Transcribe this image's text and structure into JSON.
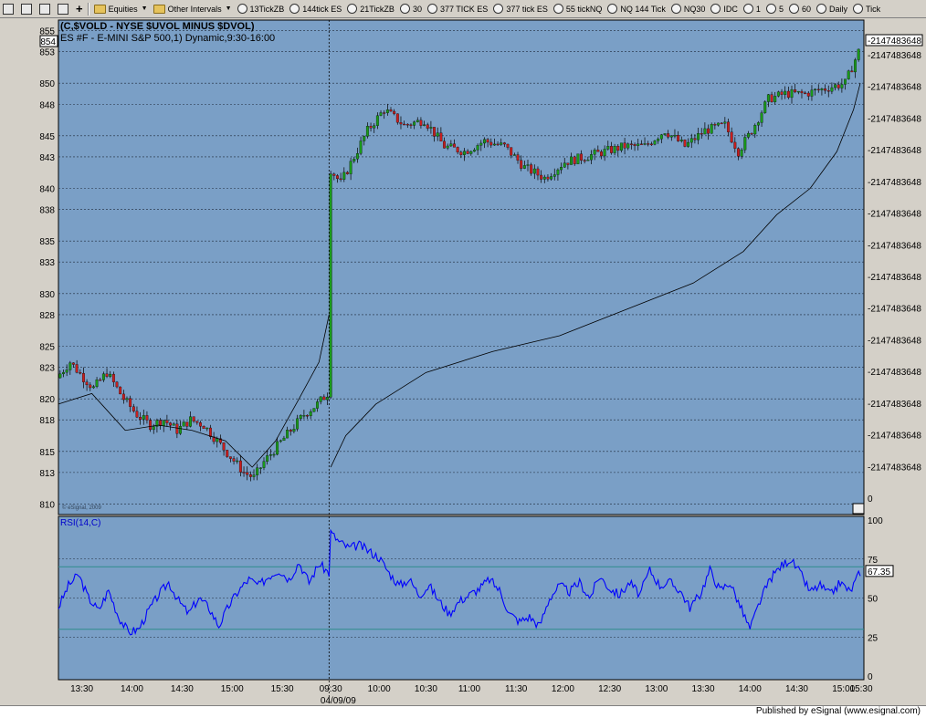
{
  "toolbar": {
    "items": [
      {
        "label": "Equities",
        "icon": "folder-icon",
        "dropdown": true
      },
      {
        "label": "Other Intervals",
        "icon": "folder-icon",
        "dropdown": true
      },
      {
        "label": "13TickZB",
        "icon": "interval-icon"
      },
      {
        "label": "144tick ES",
        "icon": "interval-icon"
      },
      {
        "label": "21TickZB",
        "icon": "interval-icon"
      },
      {
        "label": "30",
        "icon": "interval-icon"
      },
      {
        "label": "377 TICK ES",
        "icon": "interval-icon"
      },
      {
        "label": "377 tick ES",
        "icon": "interval-icon"
      },
      {
        "label": "55 tickNQ",
        "icon": "interval-icon"
      },
      {
        "label": "NQ 144 Tick",
        "icon": "interval-icon"
      },
      {
        "label": "NQ30",
        "icon": "interval-icon"
      },
      {
        "label": "IDC",
        "icon": "interval-icon"
      },
      {
        "label": "1",
        "icon": "interval-icon"
      },
      {
        "label": "5",
        "icon": "interval-icon"
      },
      {
        "label": "60",
        "icon": "interval-icon"
      },
      {
        "label": "Daily",
        "icon": "interval-icon"
      },
      {
        "label": "Tick",
        "icon": "interval-icon"
      }
    ]
  },
  "chart_data": [
    {
      "type": "candlestick",
      "title": "(C,$VOLD - NYSE $UVOL MINUS $DVOL)",
      "subtitle": "ES #F - E-MINI S&P 500,1) Dynamic,9:30-16:00",
      "watermark": "© eSignal, 2009",
      "price_ticks": [
        "855",
        "853",
        "850",
        "848",
        "845",
        "843",
        "840",
        "838",
        "835",
        "833",
        "830",
        "828",
        "825",
        "823",
        "820",
        "818",
        "815",
        "813",
        "810"
      ],
      "price_ylim": [
        809,
        856
      ],
      "last_price_label": "854",
      "right_axis_ticks": [
        "-2147483648",
        "-2147483648",
        "-2147483648",
        "-2147483648",
        "-2147483648",
        "-2147483648",
        "-2147483648",
        "-2147483648",
        "-2147483648",
        "-2147483648",
        "-2147483648",
        "-2147483648",
        "-2147483648",
        "-2147483648",
        "0"
      ],
      "right_axis_last_label": "-2147483648",
      "colors": {
        "background": "#7a9fc6",
        "up": "#1a9a1a",
        "down": "#c81e1e",
        "wick": "#000000",
        "rsi": "#0000ff",
        "band": "#2e8b8b"
      },
      "price_series": [
        {
          "x": 0,
          "y": 822
        },
        {
          "x": 4,
          "y": 823.5
        },
        {
          "x": 8,
          "y": 822
        },
        {
          "x": 11,
          "y": 821
        },
        {
          "x": 15,
          "y": 822.5
        },
        {
          "x": 20,
          "y": 820
        },
        {
          "x": 24,
          "y": 818.5
        },
        {
          "x": 28,
          "y": 817.5
        },
        {
          "x": 32,
          "y": 818
        },
        {
          "x": 36,
          "y": 817
        },
        {
          "x": 40,
          "y": 818
        },
        {
          "x": 44,
          "y": 817.5
        },
        {
          "x": 48,
          "y": 816
        },
        {
          "x": 52,
          "y": 814.5
        },
        {
          "x": 56,
          "y": 813
        },
        {
          "x": 59,
          "y": 812.5
        },
        {
          "x": 62,
          "y": 814
        },
        {
          "x": 66,
          "y": 815.5
        },
        {
          "x": 70,
          "y": 817
        },
        {
          "x": 74,
          "y": 818.5
        },
        {
          "x": 78,
          "y": 819.5
        },
        {
          "x": 81,
          "y": 820.5
        },
        {
          "x": 81.5,
          "y": 842
        },
        {
          "x": 85,
          "y": 840.5
        },
        {
          "x": 89,
          "y": 843
        },
        {
          "x": 93,
          "y": 845.5
        },
        {
          "x": 98,
          "y": 847.5
        },
        {
          "x": 104,
          "y": 846
        },
        {
          "x": 110,
          "y": 846.5
        },
        {
          "x": 116,
          "y": 844
        },
        {
          "x": 122,
          "y": 843.5
        },
        {
          "x": 128,
          "y": 844.5
        },
        {
          "x": 134,
          "y": 844
        },
        {
          "x": 140,
          "y": 842
        },
        {
          "x": 146,
          "y": 841
        },
        {
          "x": 152,
          "y": 842.5
        },
        {
          "x": 158,
          "y": 843
        },
        {
          "x": 164,
          "y": 843.5
        },
        {
          "x": 170,
          "y": 844
        },
        {
          "x": 176,
          "y": 844
        },
        {
          "x": 182,
          "y": 845.5
        },
        {
          "x": 188,
          "y": 844
        },
        {
          "x": 194,
          "y": 845.5
        },
        {
          "x": 200,
          "y": 846
        },
        {
          "x": 204,
          "y": 843.5
        },
        {
          "x": 208,
          "y": 845.5
        },
        {
          "x": 213,
          "y": 848.5
        },
        {
          "x": 218,
          "y": 849
        },
        {
          "x": 224,
          "y": 849
        },
        {
          "x": 230,
          "y": 849.5
        },
        {
          "x": 236,
          "y": 850
        },
        {
          "x": 240,
          "y": 853
        }
      ],
      "cumulative_series": [
        {
          "x": 0,
          "y": 819.5
        },
        {
          "x": 10,
          "y": 820.5
        },
        {
          "x": 20,
          "y": 817
        },
        {
          "x": 30,
          "y": 817.5
        },
        {
          "x": 40,
          "y": 817
        },
        {
          "x": 50,
          "y": 816
        },
        {
          "x": 58,
          "y": 813.5
        },
        {
          "x": 65,
          "y": 816
        },
        {
          "x": 72,
          "y": 820
        },
        {
          "x": 78,
          "y": 823.5
        },
        {
          "x": 81,
          "y": 828
        },
        {
          "x": 81.5,
          "y": 813.5
        },
        {
          "x": 86,
          "y": 816.5
        },
        {
          "x": 95,
          "y": 819.5
        },
        {
          "x": 110,
          "y": 822.5
        },
        {
          "x": 130,
          "y": 824.5
        },
        {
          "x": 150,
          "y": 826
        },
        {
          "x": 170,
          "y": 828.5
        },
        {
          "x": 190,
          "y": 831
        },
        {
          "x": 205,
          "y": 834
        },
        {
          "x": 215,
          "y": 837.5
        },
        {
          "x": 225,
          "y": 840
        },
        {
          "x": 233,
          "y": 843.5
        },
        {
          "x": 238,
          "y": 847.5
        },
        {
          "x": 240,
          "y": 850
        }
      ],
      "session_break_x": 81,
      "x_ticks": [
        {
          "x": 7,
          "label": "13:30"
        },
        {
          "x": 22,
          "label": "14:00"
        },
        {
          "x": 37,
          "label": "14:30"
        },
        {
          "x": 52,
          "label": "15:00"
        },
        {
          "x": 67,
          "label": "15:30"
        },
        {
          "x": 81.5,
          "label": "09:30"
        },
        {
          "x": 96,
          "label": "10:00"
        },
        {
          "x": 110,
          "label": "10:30"
        },
        {
          "x": 123,
          "label": "11:00"
        },
        {
          "x": 137,
          "label": "11:30"
        },
        {
          "x": 151,
          "label": "12:00"
        },
        {
          "x": 165,
          "label": "12:30"
        },
        {
          "x": 179,
          "label": "13:00"
        },
        {
          "x": 193,
          "label": "13:30"
        },
        {
          "x": 207,
          "label": "14:00"
        },
        {
          "x": 221,
          "label": "14:30"
        },
        {
          "x": 235,
          "label": "15:00"
        },
        {
          "x": 249,
          "label": "15:30"
        }
      ],
      "date_label": "04/09/09",
      "xlim": [
        0,
        240
      ]
    },
    {
      "type": "line",
      "title": "RSI(14,C)",
      "ylim": [
        0,
        100
      ],
      "y_ticks": [
        "100",
        "75",
        "50",
        "25",
        "0"
      ],
      "bands": [
        30,
        70
      ],
      "last_value_label": "67.35",
      "series": [
        {
          "x": 0,
          "y": 44
        },
        {
          "x": 3,
          "y": 58
        },
        {
          "x": 6,
          "y": 65
        },
        {
          "x": 9,
          "y": 50
        },
        {
          "x": 12,
          "y": 42
        },
        {
          "x": 15,
          "y": 55
        },
        {
          "x": 18,
          "y": 38
        },
        {
          "x": 21,
          "y": 28
        },
        {
          "x": 24,
          "y": 30
        },
        {
          "x": 27,
          "y": 42
        },
        {
          "x": 30,
          "y": 52
        },
        {
          "x": 33,
          "y": 60
        },
        {
          "x": 36,
          "y": 48
        },
        {
          "x": 39,
          "y": 40
        },
        {
          "x": 42,
          "y": 50
        },
        {
          "x": 45,
          "y": 44
        },
        {
          "x": 48,
          "y": 32
        },
        {
          "x": 51,
          "y": 45
        },
        {
          "x": 54,
          "y": 55
        },
        {
          "x": 57,
          "y": 62
        },
        {
          "x": 60,
          "y": 58
        },
        {
          "x": 63,
          "y": 64
        },
        {
          "x": 66,
          "y": 68
        },
        {
          "x": 69,
          "y": 62
        },
        {
          "x": 72,
          "y": 73
        },
        {
          "x": 75,
          "y": 60
        },
        {
          "x": 78,
          "y": 72
        },
        {
          "x": 81,
          "y": 66
        },
        {
          "x": 81.5,
          "y": 92
        },
        {
          "x": 84,
          "y": 86
        },
        {
          "x": 87,
          "y": 82
        },
        {
          "x": 90,
          "y": 84
        },
        {
          "x": 93,
          "y": 80
        },
        {
          "x": 96,
          "y": 76
        },
        {
          "x": 99,
          "y": 66
        },
        {
          "x": 102,
          "y": 58
        },
        {
          "x": 105,
          "y": 62
        },
        {
          "x": 108,
          "y": 52
        },
        {
          "x": 111,
          "y": 58
        },
        {
          "x": 114,
          "y": 48
        },
        {
          "x": 117,
          "y": 40
        },
        {
          "x": 120,
          "y": 48
        },
        {
          "x": 123,
          "y": 52
        },
        {
          "x": 126,
          "y": 56
        },
        {
          "x": 129,
          "y": 62
        },
        {
          "x": 132,
          "y": 55
        },
        {
          "x": 135,
          "y": 40
        },
        {
          "x": 138,
          "y": 35
        },
        {
          "x": 141,
          "y": 38
        },
        {
          "x": 144,
          "y": 32
        },
        {
          "x": 147,
          "y": 50
        },
        {
          "x": 150,
          "y": 58
        },
        {
          "x": 153,
          "y": 54
        },
        {
          "x": 156,
          "y": 60
        },
        {
          "x": 159,
          "y": 50
        },
        {
          "x": 162,
          "y": 64
        },
        {
          "x": 165,
          "y": 56
        },
        {
          "x": 168,
          "y": 52
        },
        {
          "x": 171,
          "y": 60
        },
        {
          "x": 174,
          "y": 52
        },
        {
          "x": 177,
          "y": 68
        },
        {
          "x": 180,
          "y": 58
        },
        {
          "x": 183,
          "y": 60
        },
        {
          "x": 186,
          "y": 55
        },
        {
          "x": 189,
          "y": 44
        },
        {
          "x": 192,
          "y": 52
        },
        {
          "x": 195,
          "y": 68
        },
        {
          "x": 198,
          "y": 55
        },
        {
          "x": 201,
          "y": 60
        },
        {
          "x": 204,
          "y": 45
        },
        {
          "x": 207,
          "y": 30
        },
        {
          "x": 210,
          "y": 48
        },
        {
          "x": 213,
          "y": 62
        },
        {
          "x": 216,
          "y": 70
        },
        {
          "x": 219,
          "y": 75
        },
        {
          "x": 222,
          "y": 66
        },
        {
          "x": 225,
          "y": 54
        },
        {
          "x": 228,
          "y": 58
        },
        {
          "x": 231,
          "y": 52
        },
        {
          "x": 234,
          "y": 60
        },
        {
          "x": 237,
          "y": 54
        },
        {
          "x": 240,
          "y": 67
        }
      ]
    }
  ],
  "status": {
    "published": "Published by eSignal (www.esignal.com)"
  }
}
